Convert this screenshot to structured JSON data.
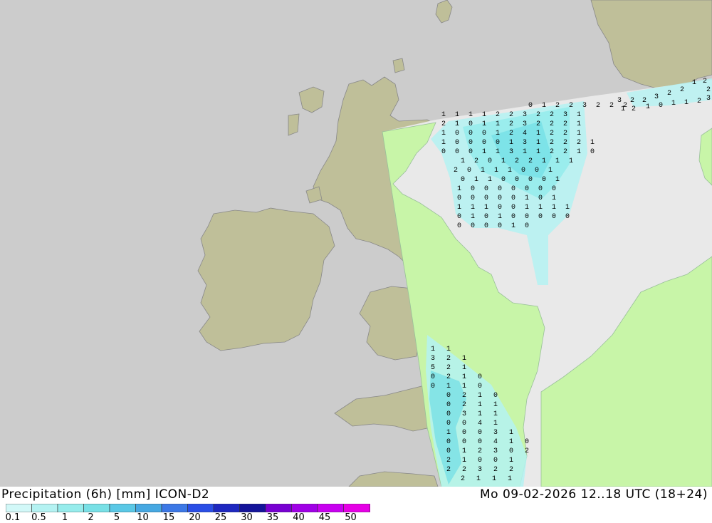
{
  "header": {
    "product": "Precipitation (6h) [mm] ICON-D2",
    "valid_time": "Mo 09-02-2026 12..18 UTC (18+24)"
  },
  "colors": {
    "sea": "#cccccc",
    "land_outside": "#bfbf99",
    "land_model": "#c8f5a8",
    "sea_model": "#e9e9e9"
  },
  "legend": {
    "ticks": [
      "0.1",
      "0.5",
      "1",
      "2",
      "5",
      "10",
      "15",
      "20",
      "25",
      "30",
      "35",
      "40",
      "45",
      "50"
    ],
    "colors": [
      "#d2f8f8",
      "#b4f2f2",
      "#96ecec",
      "#78e0e6",
      "#5ac8e6",
      "#46a8e2",
      "#3c78e6",
      "#2a4ee6",
      "#1e28c0",
      "#14149a",
      "#7800d2",
      "#a000e6",
      "#c800f0",
      "#e600e6",
      "#be00be"
    ]
  },
  "precip_values": [
    "0",
    "1",
    "2",
    "2",
    "3",
    "2",
    "2",
    "2",
    "1",
    "1",
    "1",
    "1",
    "2",
    "2",
    "3",
    "2",
    "2",
    "3",
    "1",
    "2",
    "1",
    "0",
    "1",
    "1",
    "2",
    "3",
    "2",
    "2",
    "2",
    "1",
    "1",
    "0",
    "0",
    "0",
    "1",
    "2",
    "4",
    "1",
    "2",
    "2",
    "1",
    "1",
    "0",
    "0",
    "0",
    "0",
    "1",
    "3",
    "1",
    "2",
    "2",
    "2",
    "1",
    "0",
    "0",
    "0",
    "1",
    "1",
    "3",
    "1",
    "1",
    "2",
    "2",
    "1",
    "0",
    "1",
    "2",
    "0",
    "1",
    "2",
    "2",
    "1",
    "1",
    "1",
    "2",
    "0",
    "1",
    "1",
    "1",
    "0",
    "0",
    "1",
    "0",
    "1",
    "1",
    "0",
    "0",
    "0",
    "0",
    "1",
    "1",
    "0",
    "0",
    "0",
    "0",
    "0",
    "0",
    "0",
    "0",
    "0",
    "0",
    "0",
    "0",
    "1",
    "0",
    "1",
    "1",
    "1",
    "1",
    "0",
    "0",
    "1",
    "1",
    "1",
    "1",
    "0",
    "1",
    "0",
    "1",
    "0",
    "0",
    "0",
    "0",
    "0",
    "0",
    "0",
    "0",
    "0",
    "1",
    "0",
    "1",
    "1",
    "3",
    "2",
    "1",
    "5",
    "2",
    "1",
    "0",
    "2",
    "1",
    "0",
    "0",
    "1",
    "1",
    "0",
    "0",
    "2",
    "1",
    "0",
    "0",
    "2",
    "1",
    "1",
    "0",
    "3",
    "1",
    "1",
    "0",
    "0",
    "4",
    "1",
    "1",
    "0",
    "0",
    "3",
    "1",
    "0",
    "0",
    "0",
    "4",
    "1",
    "0",
    "0",
    "1",
    "2",
    "3",
    "0",
    "2",
    "2",
    "1",
    "0"
  ]
}
